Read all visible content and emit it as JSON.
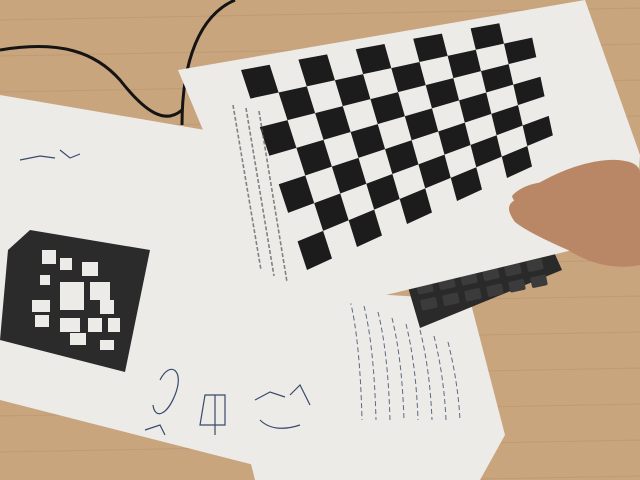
{
  "photo": {
    "colors": {
      "desk": "#c9a57e",
      "desk_dark": "#8f6c4f",
      "paper": "#ecebe8",
      "paper_shadow": "#c9c6c0",
      "checker_dark": "#1c1c1c",
      "marker_dark": "#2b2b2b",
      "keyboard": "#2a2a2a",
      "key": "#3b3b3b",
      "skin": "#b98766",
      "cable": "#141414",
      "ink": "#3a4a6a"
    },
    "objects": [
      "wooden-desk",
      "black-cable",
      "checkerboard-calibration-sheet",
      "fiducial-marker-sheet",
      "handwritten-notes-sheet",
      "keyboard",
      "hand"
    ],
    "checkerboard": {
      "columns": 10,
      "rows": 7
    }
  }
}
